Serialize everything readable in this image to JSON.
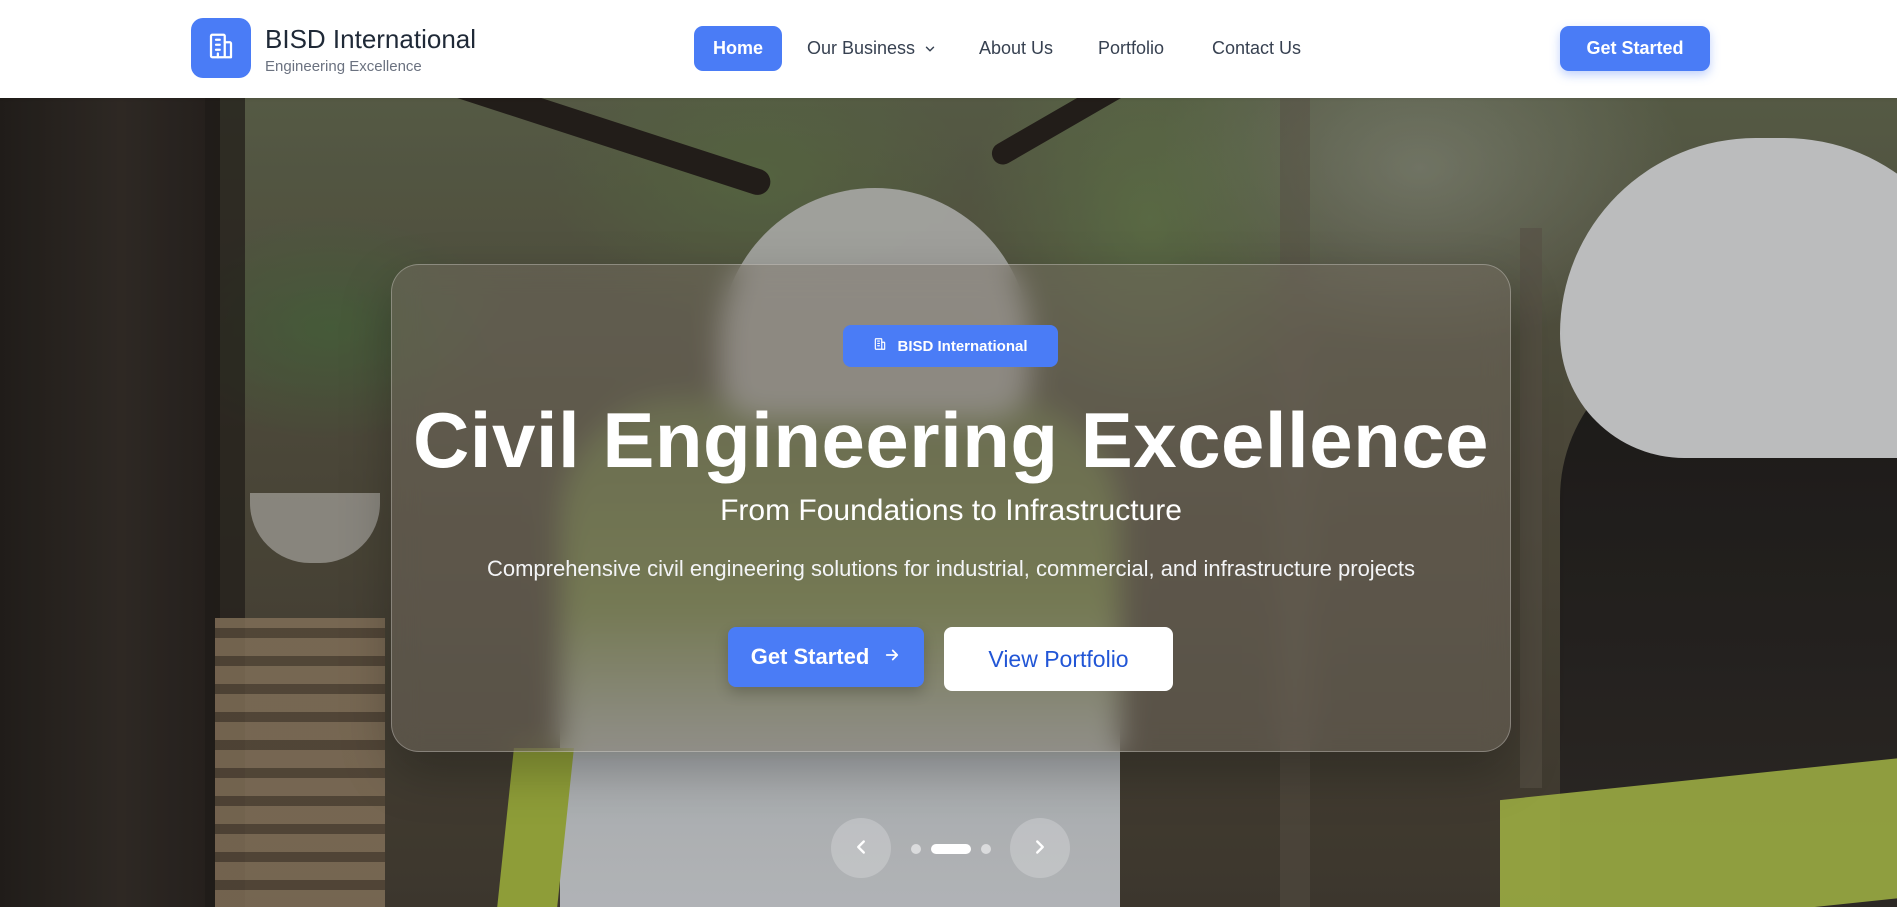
{
  "brand": {
    "name": "BISD International",
    "tagline": "Engineering Excellence",
    "logo_icon": "building-icon"
  },
  "nav": {
    "items": [
      {
        "label": "Home",
        "active": true
      },
      {
        "label": "Our Business",
        "has_dropdown": true
      },
      {
        "label": "About Us"
      },
      {
        "label": "Portfolio"
      },
      {
        "label": "Contact Us"
      }
    ],
    "cta_label": "Get Started"
  },
  "hero": {
    "badge_label": "BISD International",
    "badge_icon": "building-icon",
    "title": "Civil Engineering Excellence",
    "subtitle": "From Foundations to Infrastructure",
    "description": "Comprehensive civil engineering solutions for industrial, commercial, and infrastructure projects",
    "primary_button": "Get Started",
    "primary_button_icon": "arrow-right-icon",
    "secondary_button": "View Portfolio"
  },
  "carousel": {
    "slide_count": 3,
    "active_slide": 2
  },
  "colors": {
    "accent": "#4a7cf6",
    "secondary_text": "#2256d6",
    "nav_text": "#374151"
  }
}
